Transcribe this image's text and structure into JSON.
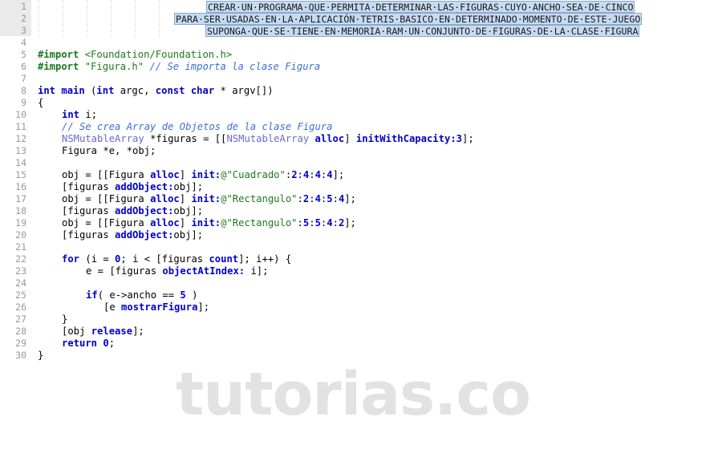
{
  "editor": {
    "title": "Objective-C source editor",
    "language": "Objective-C",
    "watermark": "tutorias.co",
    "whitespace_dot": "·",
    "colors": {
      "background": "#ffffff",
      "gutter_text": "#999999",
      "gutter_highlight": "#eaeaea",
      "selection_fill": "#c6dbf2",
      "selection_border": "#8aa9cc",
      "keyword": "#0000cd",
      "preprocessor": "#1a7a1a",
      "string": "#1a7a1a",
      "number": "#0000cd",
      "class_name": "#6a6ad4",
      "message": "#0000cd",
      "comment": "#3b6fd4",
      "plain": "#000000",
      "indent_guide": "#c9c9c9",
      "watermark": "#e2e2e2"
    }
  },
  "line_numbers": [
    "1",
    "2",
    "3",
    "4",
    "5",
    "6",
    "7",
    "8",
    "9",
    "10",
    "11",
    "12",
    "13",
    "14",
    "15",
    "16",
    "17",
    "18",
    "19",
    "20",
    "21",
    "22",
    "23",
    "24",
    "25",
    "26",
    "27",
    "28",
    "29",
    "30"
  ],
  "selection": {
    "line1": "CREAR·UN·PROGRAMA·QUE·PERMITA·DETERMINAR·LAS·FIGURAS·CUYO·ANCHO·SEA·DE·CINCO",
    "line2": "PARA·SER·USADAS·EN·LA·APLICACIÓN·TETRIS·BASICO·EN·DETERMINADO·MOMENTO·DE·ESTE·JUEGO",
    "line3": "SUPONGA·QUE·SE·TIENE·EN·MEMORIA·RAM·UN·CONJUNTO·DE·FIGURAS·DE·LA·CLASE·FIGURA",
    "plain_line1": "CREAR UN PROGRAMA QUE PERMITA DETERMINAR LAS FIGURAS CUYO ANCHO SEA DE CINCO",
    "plain_line2": "PARA SER USADAS EN LA APLICACIÓN TETRIS BASICO EN DETERMINADO MOMENTO DE ESTE JUEGO",
    "plain_line3": "SUPONGA QUE SE TIENE EN MEMORIA RAM UN CONJUNTO DE FIGURAS DE LA CLASE FIGURA"
  },
  "code": {
    "l5_import": "#import",
    "l5_header": "<Foundation/Foundation.h>",
    "l6_import": "#import",
    "l6_header": "\"Figura.h\"",
    "l6_comment": "// Se importa la clase Figura",
    "l8_int": "int",
    "l8_main": "main",
    "l8_open": " (",
    "l8_int2": "int",
    "l8_argc": " argc, ",
    "l8_const": "const",
    "l8_char": "char",
    "l8_rest": " * argv[])",
    "l9_brace": "{",
    "l10_int": "int",
    "l10_i": " i;",
    "l11_comment": "// Se crea Array de Objetos de la clase Figura",
    "l12_cls": "NSMutableArray",
    "l12_var": " *figuras = [[",
    "l12_cls2": "NSMutableArray",
    "l12_alloc": "alloc",
    "l12_close": "] ",
    "l12_init": "initWithCapacity:",
    "l12_num": "3",
    "l12_end": "];",
    "l13": "Figura *e, *obj;",
    "l15_pre": "obj = [[Figura ",
    "l15_alloc": "alloc",
    "l15_mid": "] ",
    "l15_init": "init:",
    "l15_at": "@",
    "l15_str": "\"Cuadrado\"",
    "l15_colon": ":",
    "l15_n1": "2",
    "l15_n2": "4",
    "l15_n3": "4",
    "l15_n4": "4",
    "l15_end": "];",
    "l16_pre": "[figuras ",
    "l16_msg": "addObject:",
    "l16_end": "obj];",
    "l17_pre": "obj = [[Figura ",
    "l17_alloc": "alloc",
    "l17_mid": "] ",
    "l17_init": "init:",
    "l17_at": "@",
    "l17_str": "\"Rectangulo\"",
    "l17_n1": "2",
    "l17_n2": "4",
    "l17_n3": "5",
    "l17_n4": "4",
    "l17_end": "];",
    "l18_pre": "[figuras ",
    "l18_msg": "addObject:",
    "l18_end": "obj];",
    "l19_pre": "obj = [[Figura ",
    "l19_alloc": "alloc",
    "l19_mid": "] ",
    "l19_init": "init:",
    "l19_at": "@",
    "l19_str": "\"Rectangulo\"",
    "l19_n1": "5",
    "l19_n2": "5",
    "l19_n3": "4",
    "l19_n4": "2",
    "l19_end": "];",
    "l20_pre": "[figuras ",
    "l20_msg": "addObject:",
    "l20_end": "obj];",
    "l22_for": "for",
    "l22_a": " (i = ",
    "l22_zero": "0",
    "l22_b": "; i < [figuras ",
    "l22_count": "count",
    "l22_c": "]; i++) {",
    "l23_pre": "e = [figuras ",
    "l23_msg": "objectAtIndex:",
    "l23_end": " i];",
    "l25_if": "if",
    "l25_cond": "( e->ancho == ",
    "l25_num": "5",
    "l25_close": " )",
    "l26_pre": "[e ",
    "l26_msg": "mostrarFigura",
    "l26_end": "];",
    "l27_brace": "}",
    "l28_pre": "[obj ",
    "l28_msg": "release",
    "l28_end": "];",
    "l29_ret": "return",
    "l29_zero": "0",
    "l29_end": ";",
    "l30_brace": "}"
  }
}
